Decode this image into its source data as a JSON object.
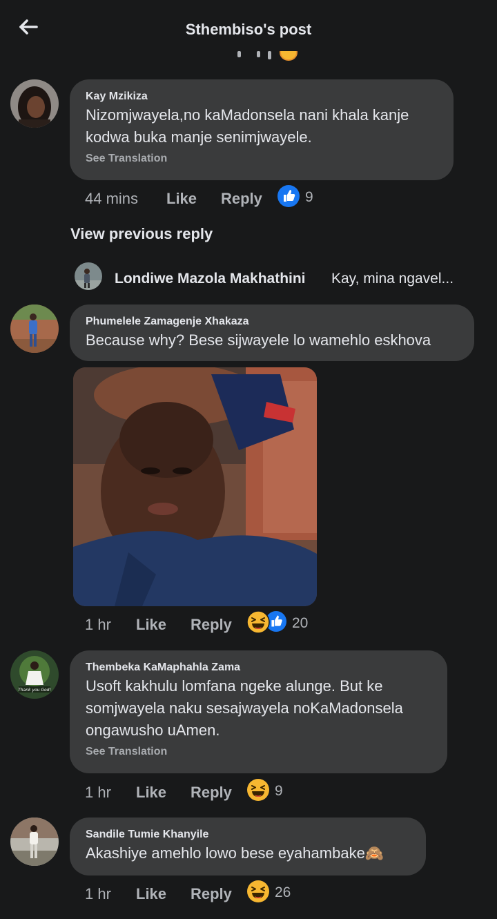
{
  "header": {
    "title": "Sthembiso's post",
    "back_icon": "arrow-left-icon"
  },
  "comments": [
    {
      "author": "Kay Mzikiza",
      "text_lines": [
        "Nizomjwayela,no kaMadonsela nani khala kanje",
        "kodwa buka manje senimjwayele."
      ],
      "see_translation": "See Translation",
      "time": "44 mins",
      "like": "Like",
      "reply": "Reply",
      "reactions": [
        "like-reaction-icon"
      ],
      "reaction_count": "9"
    },
    {
      "author": "Phumelele Zamagenje Xhakaza",
      "text_lines": [
        "Because why? Bese sijwayele lo wamehlo eskhova"
      ],
      "time": "1 hr",
      "like": "Like",
      "reply": "Reply",
      "reactions": [
        "haha-reaction-icon",
        "like-reaction-icon"
      ],
      "reaction_count": "20"
    },
    {
      "author": "Thembeka KaMaphahla Zama",
      "text_lines": [
        "Usoft kakhulu lomfana ngeke alunge. But ke",
        "somjwayela naku sesajwayela noKaMadonsela",
        "ongawusho uAmen."
      ],
      "see_translation": "See Translation",
      "time": "1 hr",
      "like": "Like",
      "reply": "Reply",
      "reactions": [
        "haha-reaction-icon"
      ],
      "reaction_count": "9"
    },
    {
      "author": "Sandile Tumie Khanyile",
      "text_lines": [
        "Akashiye amehlo lowo bese eyahambake🙈"
      ],
      "time": "1 hr",
      "like": "Like",
      "reply": "Reply",
      "reactions": [
        "haha-reaction-icon"
      ],
      "reaction_count": "26"
    }
  ],
  "view_previous_reply": "View previous reply",
  "reply_preview": {
    "name": "Londiwe Mazola Makhathini",
    "text": "Kay, mina ngavel..."
  },
  "colors": {
    "background": "#18191a",
    "bubble": "#3a3b3c",
    "text": "#e4e6eb",
    "secondary": "#b0b3b8",
    "like_blue": "#1877f2",
    "haha_yellow": "#f7b731"
  }
}
